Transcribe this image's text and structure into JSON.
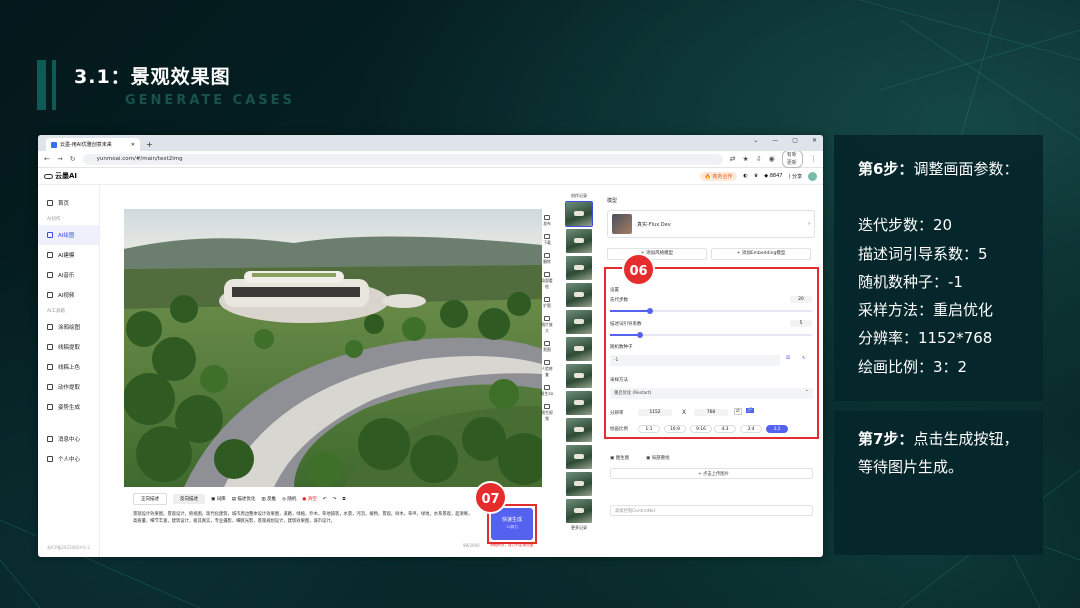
{
  "slide": {
    "title": "3.1：景观效果图",
    "subtitle": "GENERATE CASES"
  },
  "browser": {
    "tab_title": "云墨-用AI优雅创意未来",
    "url": "yunmoai.com/#/main/text2img",
    "update_button": "有新更新"
  },
  "app": {
    "logo_text": "云墨AI",
    "coop_label": "🔥 商务合作",
    "points": "8847",
    "share_label": "分享"
  },
  "sidebar": {
    "home": "首页",
    "group_ai_create": "AI创作",
    "items_create": [
      "AI绘图",
      "AI建模",
      "AI音乐",
      "AI视频"
    ],
    "group_ai_tools": "AI工具箱",
    "items_tools": [
      "涂鸦绘图",
      "线稿提取",
      "线稿上色",
      "动作提取",
      "姿势生成"
    ],
    "messages": "消息中心",
    "profile": "个人中心",
    "footer": "浙ICP备2023080X号-2"
  },
  "toolbar": [
    "发布",
    "下载",
    "删除",
    "局部重绘",
    "扩图",
    "图片放大",
    "抠图",
    "人脸修复",
    "图生3D",
    "图生视频"
  ],
  "prompt": {
    "tab_positive": "正向描述",
    "tab_negative": "反向描述",
    "tools": [
      "词库",
      "描述优化",
      "反推",
      "随机",
      "清空"
    ],
    "text": "景观设计效果图。景观设计，俯视图，现代化建筑，城市周边整体设计效果图，道路，绿植，乔木，草地铺装，水景，河流，植物，景观，树木，草坪，绿地，水系景观，超清晰，高质量，细节丰富，建筑设计，极其真实，专业摄影，细腻光影，景观规划设计，建筑效果图，城市设计。",
    "count": "98/2000"
  },
  "generate": {
    "label": "快速生成",
    "sub": "12算力",
    "note": "消耗积分，算力不足请充值"
  },
  "history": {
    "title": "创作记录",
    "thumb_label": "文生图",
    "more": "更多记录"
  },
  "settings": {
    "model_section": "模型",
    "model_name": "真实-Flux Dev",
    "add_lora": "添加风格模型",
    "add_embedding": "添加Embedding模型",
    "section": "设置",
    "steps_label": "迭代步数",
    "steps_value": "20",
    "steps_fraction": 0.2,
    "cfg_label": "描述词引导系数",
    "cfg_value": "5",
    "cfg_fraction": 0.15,
    "seed_label": "随机数种子",
    "seed_value": "-1",
    "sampler_label": "采样方法",
    "sampler_value": "重启优化 (Restart)",
    "resolution_label": "分辨率",
    "width": "1152",
    "x_label": "X",
    "height": "768",
    "ratio_label": "绘画比例",
    "ratios": [
      "1:1",
      "16:9",
      "9:16",
      "4:3",
      "3:4",
      "3:2"
    ],
    "ratio_selected": "3:2",
    "img2img": "图生图",
    "controlnet": "局部重绘",
    "upload": "点击上传图片",
    "advanced": "高级控制ControlNet"
  },
  "badges": {
    "step6": "06",
    "step7": "07"
  },
  "notes": {
    "step6_title": "第6步：",
    "step6_rest": "调整画面参数：",
    "params": [
      "迭代步数：20",
      "描述词引导系数：5",
      "随机数种子：-1",
      "采样方法：重启优化",
      "分辨率：1152*768",
      "绘画比例：3：2"
    ],
    "step7_title": "第7步：",
    "step7_rest": "点击生成按钮，",
    "step7_line2": "等待图片生成。"
  },
  "colors": {
    "accent": "#5561ef",
    "highlight": "#e52d2d",
    "background": "#041a1d"
  }
}
